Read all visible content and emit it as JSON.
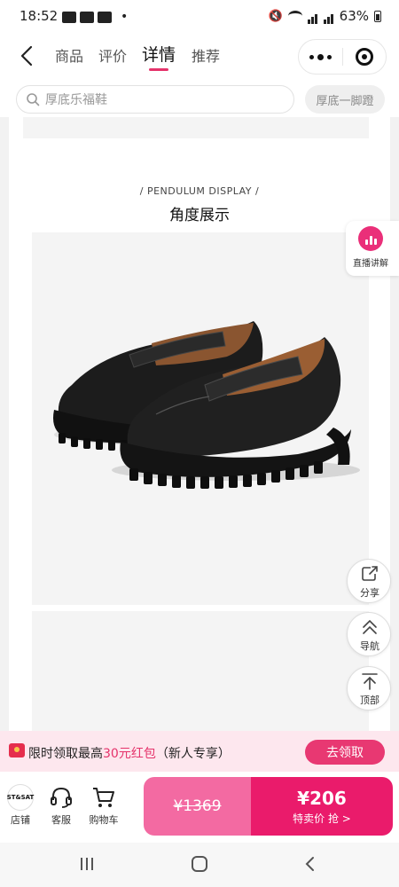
{
  "status_bar": {
    "time": "18:52",
    "battery": "63%",
    "dot": "•"
  },
  "nav": {
    "tabs": [
      {
        "label": "商品",
        "active": false
      },
      {
        "label": "评价",
        "active": false
      },
      {
        "label": "详情",
        "active": true
      },
      {
        "label": "推荐",
        "active": false
      }
    ]
  },
  "search": {
    "placeholder": "厚底乐福鞋",
    "chip": "厚底一脚蹬"
  },
  "section": {
    "subtitle_en": "/  PENDULUM DISPLAY  /",
    "title_cn": "角度展示"
  },
  "floating": {
    "live_label": "直播讲解",
    "share_label": "分享",
    "guide_label": "导航",
    "top_label": "顶部"
  },
  "promo": {
    "text_before": "限时领取最高",
    "highlight": "30元红包",
    "text_after": "（新人专享）",
    "button": "去领取"
  },
  "bottom_bar": {
    "store_logo_text": "ST&SAT",
    "store_label": "店铺",
    "service_label": "客服",
    "cart_label": "购物车",
    "original_price": "¥1369",
    "sale_price": "¥206",
    "sale_caption": "特卖价 抢 >"
  },
  "colors": {
    "accent": "#e5336b",
    "buy_light": "#f36aa2",
    "buy_dark": "#ea1b6b",
    "promo_bg": "#fde7ee"
  }
}
